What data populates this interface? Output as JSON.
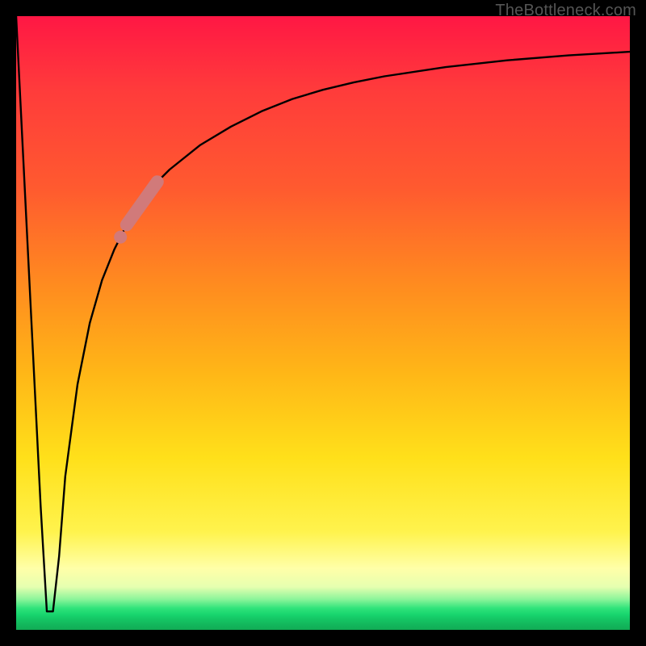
{
  "watermark": "TheBottleneck.com",
  "colors": {
    "frame": "#000000",
    "curve": "#000000",
    "highlight": "#d17a7a",
    "gradient_top": "#ff1744",
    "gradient_mid": "#ffe01a",
    "gradient_bottom": "#11ab55"
  },
  "chart_data": {
    "type": "line",
    "title": "",
    "xlabel": "",
    "ylabel": "",
    "xlim": [
      0,
      100
    ],
    "ylim": [
      0,
      100
    ],
    "grid": false,
    "legend": false,
    "series": [
      {
        "name": "bottleneck-curve",
        "x": [
          0,
          2,
          4,
          5,
          6,
          7,
          8,
          10,
          12,
          14,
          16,
          18,
          20,
          22,
          25,
          30,
          35,
          40,
          45,
          50,
          55,
          60,
          70,
          80,
          90,
          100
        ],
        "values": [
          100,
          60,
          20,
          3,
          3,
          12,
          25,
          40,
          50,
          57,
          62,
          66,
          69,
          72,
          75,
          79,
          82,
          84.5,
          86.5,
          88,
          89.2,
          90.2,
          91.7,
          92.8,
          93.6,
          94.2
        ]
      }
    ],
    "highlight": {
      "segment_start_x": 18,
      "segment_end_x": 23,
      "dot_x": 17,
      "dot_y": 64
    },
    "optimum_x": 5.5
  }
}
